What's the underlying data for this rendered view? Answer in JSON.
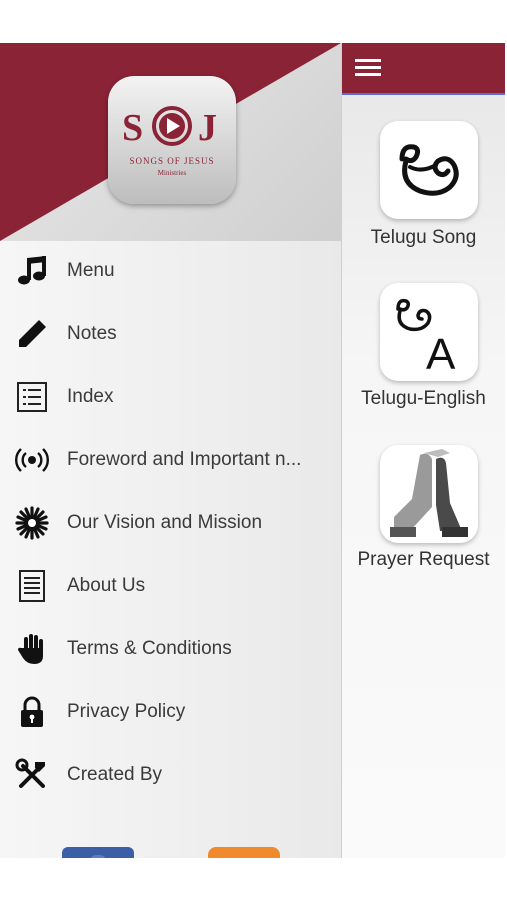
{
  "drawer": {
    "logo": {
      "text_main": "SJ",
      "text_sub": "SONGS OF JESUS",
      "text_tag": "Ministries"
    },
    "items": [
      {
        "label": "Menu",
        "icon": "music-note-icon"
      },
      {
        "label": "Notes",
        "icon": "pencil-icon"
      },
      {
        "label": "Index",
        "icon": "list-icon"
      },
      {
        "label": "Foreword and Important n...",
        "icon": "broadcast-icon"
      },
      {
        "label": "Our Vision and Mission",
        "icon": "starburst-icon"
      },
      {
        "label": "About Us",
        "icon": "document-icon"
      },
      {
        "label": "Terms & Conditions",
        "icon": "hand-icon"
      },
      {
        "label": "Privacy Policy",
        "icon": "lock-icon"
      },
      {
        "label": "Created By",
        "icon": "tools-icon"
      }
    ],
    "social": [
      {
        "name": "facebook-icon",
        "color": "#3b5fa6"
      },
      {
        "name": "rss-icon",
        "color": "#f08a2c"
      }
    ]
  },
  "main": {
    "tiles": [
      {
        "label": "Telugu Song",
        "icon": "telugu-letter-icon",
        "glyph": "ఆ"
      },
      {
        "label": "Telugu-English",
        "icon": "telugu-english-icon",
        "glyph": "ఆ",
        "glyph2": "A"
      },
      {
        "label": "Prayer Request",
        "icon": "praying-hands-icon"
      }
    ]
  },
  "colors": {
    "brand": "#8b2336",
    "accent_line": "#5b6ec4",
    "text": "#3a3a3a"
  }
}
